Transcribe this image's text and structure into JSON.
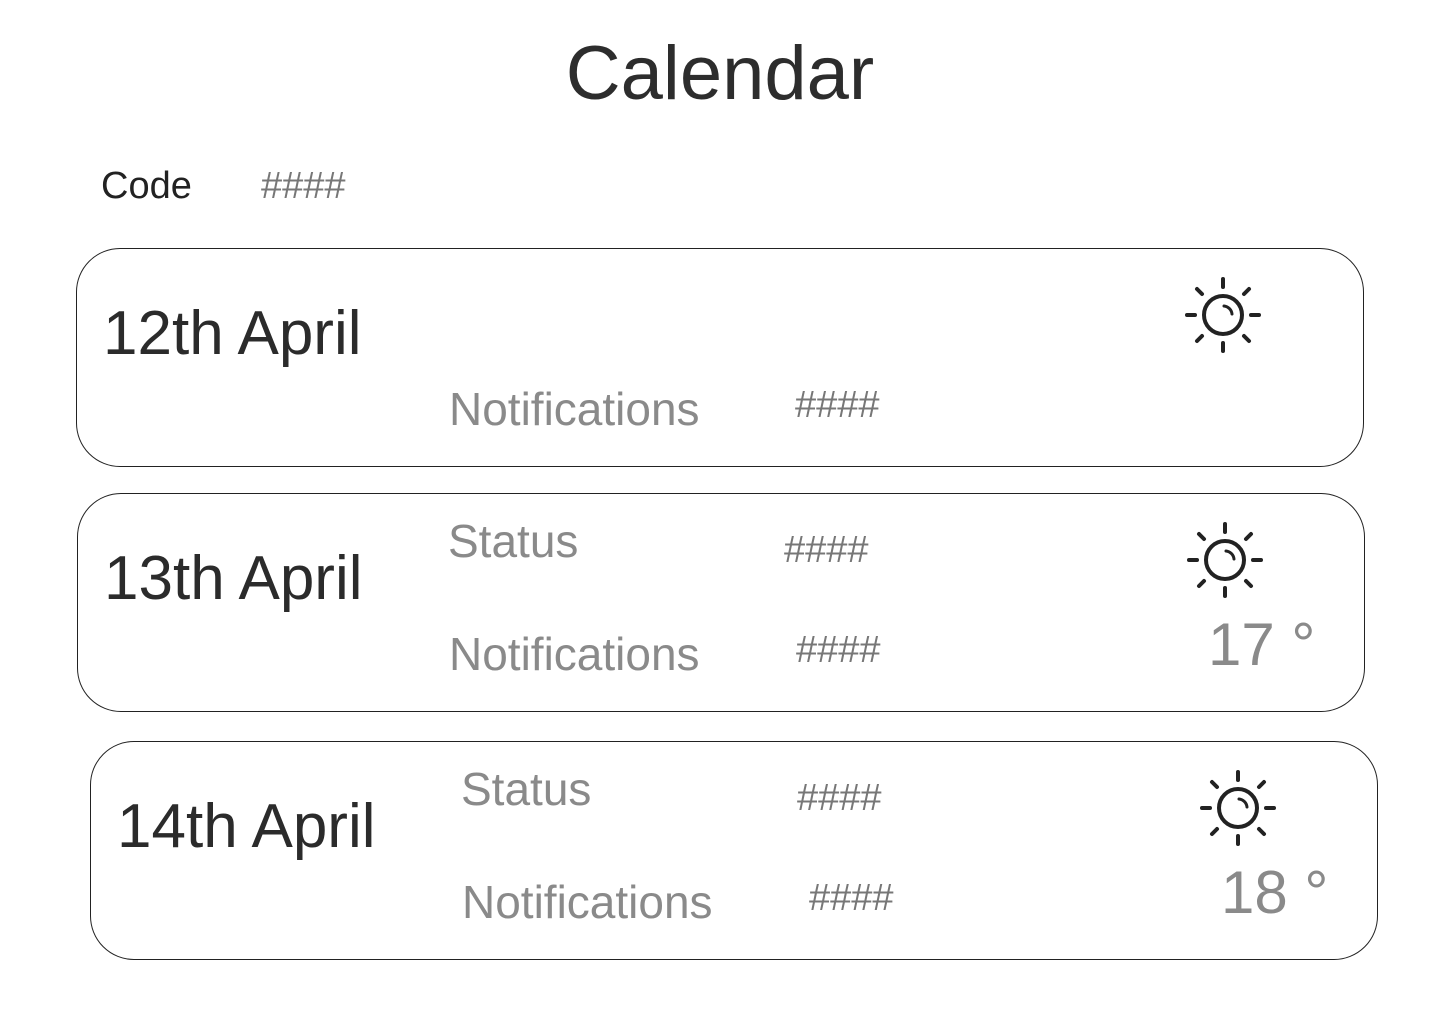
{
  "page": {
    "title": "Calendar"
  },
  "code": {
    "label": "Code",
    "value": "####"
  },
  "days": [
    {
      "date": "12th April",
      "notifications_label": "Notifications",
      "notifications_value": "####",
      "weather_icon": "sun-icon"
    },
    {
      "date": "13th April",
      "status_label": "Status",
      "status_value": "####",
      "notifications_label": "Notifications",
      "notifications_value": "####",
      "temperature": "17 °",
      "weather_icon": "sun-icon"
    },
    {
      "date": "14th April",
      "status_label": "Status",
      "status_value": "####",
      "notifications_label": "Notifications",
      "notifications_value": "####",
      "temperature": "18 °",
      "weather_icon": "sun-icon"
    }
  ]
}
